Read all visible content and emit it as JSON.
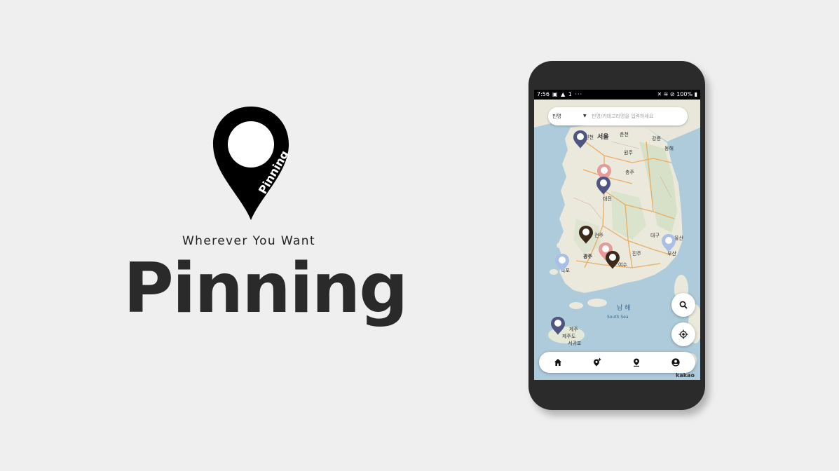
{
  "brand": {
    "tagline": "Wherever You Want",
    "wordmark": "Pinning",
    "logo_text": "Pinning"
  },
  "status_bar": {
    "time": "7:56",
    "left_icons": "▣ ▲ 1 ···",
    "right_icons": "✕ ≋ ⊘ 100% ▮",
    "battery": "100%"
  },
  "search": {
    "select_value": "핀명",
    "placeholder": "핀명/카테고리명을 입력하세요"
  },
  "map": {
    "attribution": "kakao",
    "labels": {
      "seoul": "서울",
      "incheon": "인천",
      "chuncheon": "춘천",
      "gangneung": "강릉",
      "donghae": "동해",
      "wonju": "원주",
      "chungju": "충주",
      "daejeon": "대전",
      "jeonju": "전주",
      "gwangju": "광주",
      "daegu": "대구",
      "ulsan": "울산",
      "busan": "부산",
      "jinju": "진주",
      "yeosu": "여수",
      "mokpo": "목포",
      "jeju": "제주",
      "jeju_island": "제주도",
      "seogwipo": "서귀포",
      "sea": "남 해",
      "sea_en": "South Sea"
    },
    "pin_colors": {
      "navy": "#4f5580",
      "pink": "#e79a9a",
      "brown": "#3b2a1a",
      "lightblue": "#a9bfe6"
    }
  },
  "nav": {
    "home_icon": "home-icon",
    "add_pin_icon": "add-location-icon",
    "pin_icon": "location-pin-icon",
    "profile_icon": "account-circle-icon"
  }
}
